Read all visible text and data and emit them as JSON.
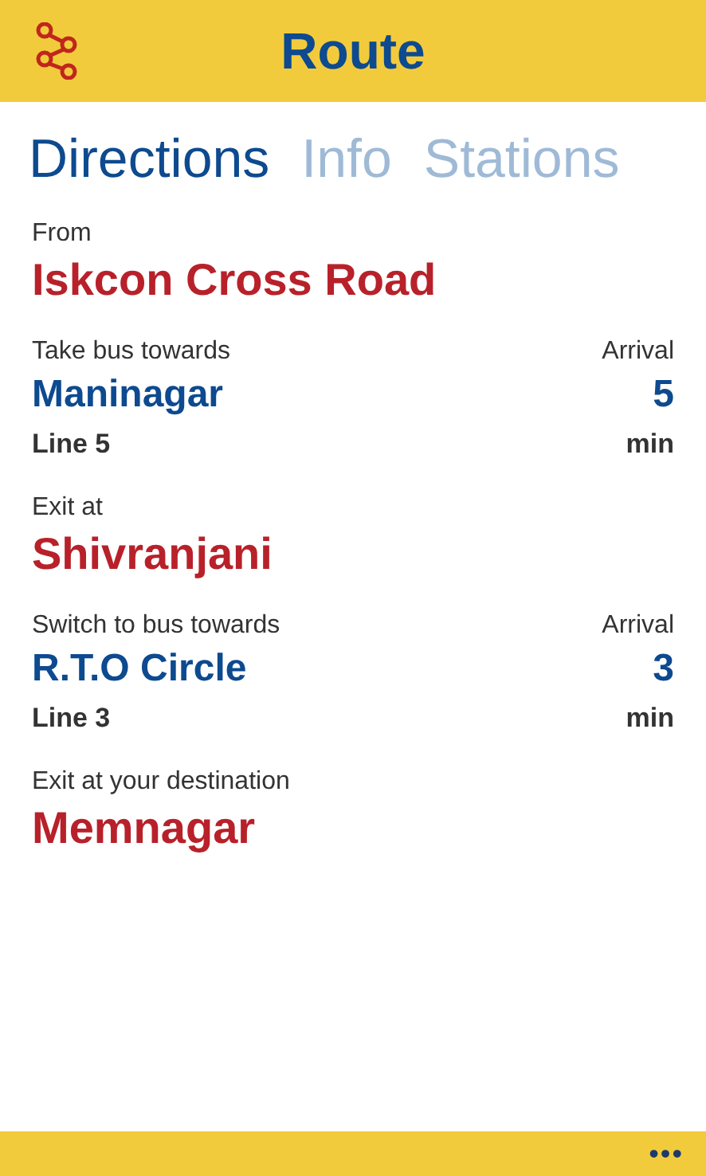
{
  "header": {
    "title": "Route"
  },
  "tabs": [
    {
      "label": "Directions",
      "selected": true
    },
    {
      "label": "Info",
      "selected": false
    },
    {
      "label": "Stations",
      "selected": false
    }
  ],
  "steps": [
    {
      "kind": "place",
      "label": "From",
      "place": "Iskcon Cross Road"
    },
    {
      "kind": "bus",
      "label": "Take bus towards",
      "arrival_label": "Arrival",
      "destination": "Maninagar",
      "line": "Line 5",
      "arrival": "5",
      "unit": "min"
    },
    {
      "kind": "place",
      "label": "Exit at",
      "place": "Shivranjani"
    },
    {
      "kind": "bus",
      "label": "Switch to bus towards",
      "arrival_label": "Arrival",
      "destination": "R.T.O Circle",
      "line": "Line 3",
      "arrival": "3",
      "unit": "min"
    },
    {
      "kind": "place",
      "label": "Exit at your destination",
      "place": "Memnagar"
    }
  ],
  "app_bar": {
    "more": "•••"
  }
}
